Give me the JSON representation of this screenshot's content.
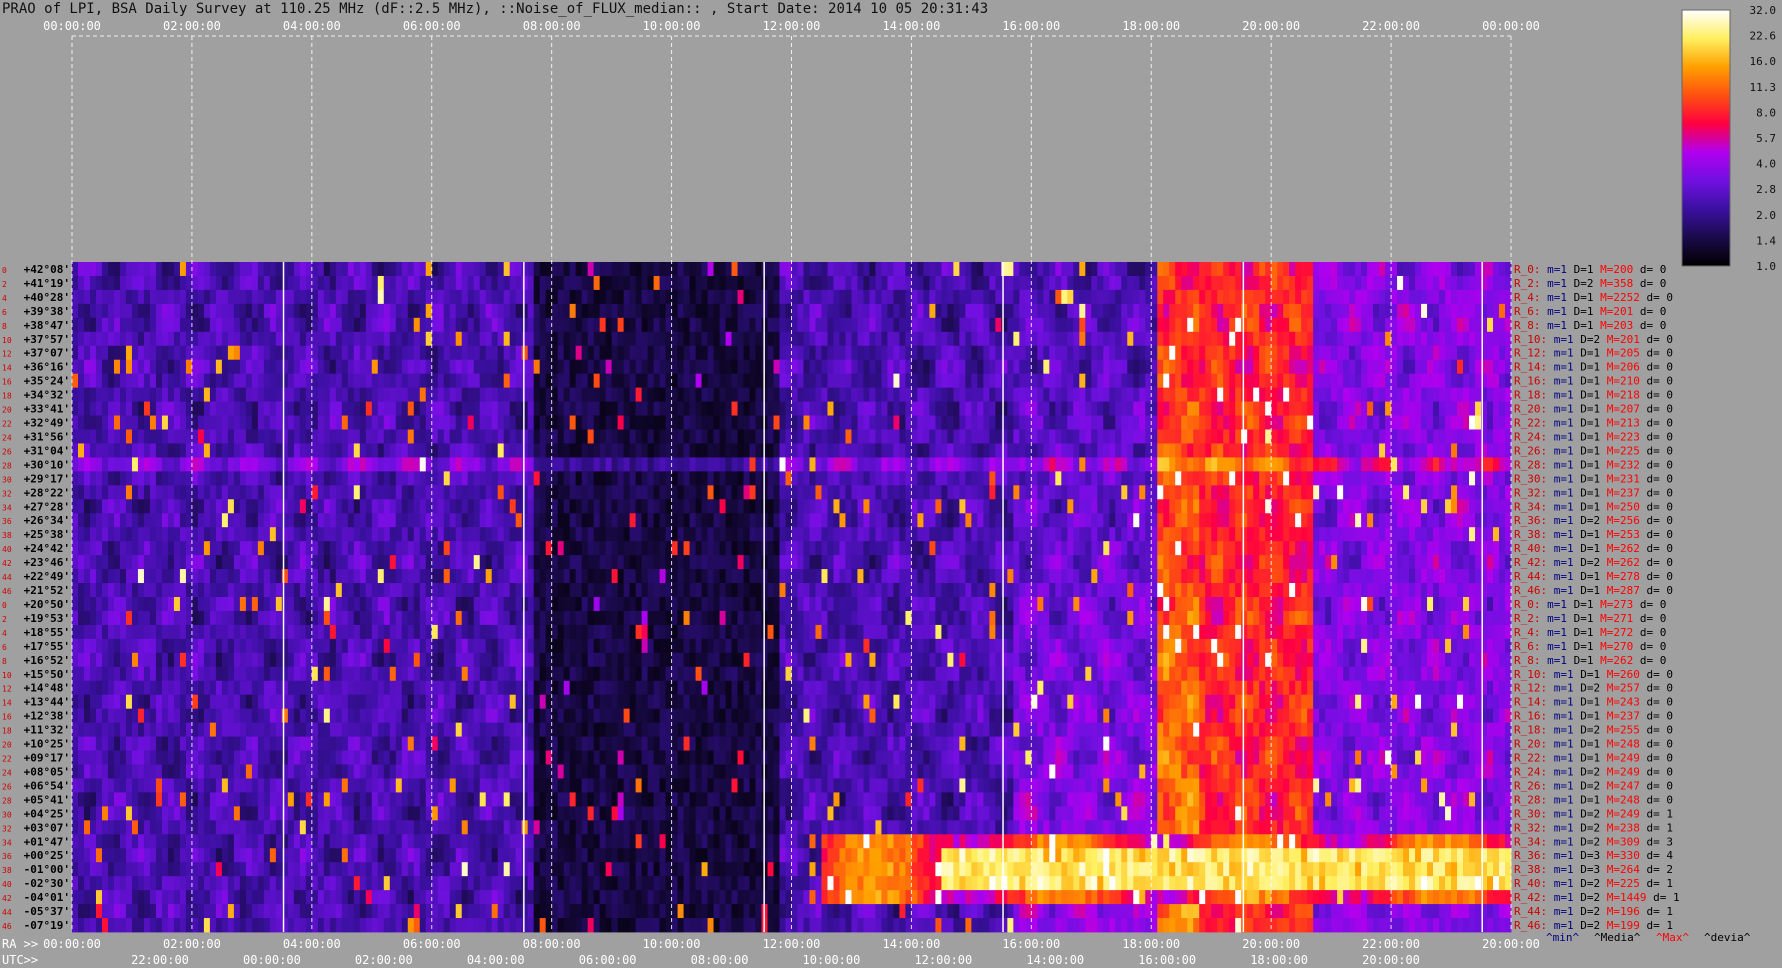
{
  "title": "PRAO of LPI, BSA Daily Survey at 110.25 MHz (dF::2.5 MHz), ::Noise_of_FLUX_median:: , Start Date: 2014 10 05 20:31:43",
  "chart_data": {
    "type": "heatmap",
    "title": "PRAO of LPI, BSA Daily Survey at 110.25 MHz (dF::2.5 MHz), ::Noise_of_FLUX_median:: , Start Date: 2014 10 05 20:31:43",
    "top_axis_ticks": [
      "00:00:00",
      "02:00:00",
      "04:00:00",
      "06:00:00",
      "08:00:00",
      "10:00:00",
      "12:00:00",
      "14:00:00",
      "16:00:00",
      "18:00:00",
      "20:00:00",
      "22:00:00",
      "00:00:00"
    ],
    "ra_axis_label": "RA >>",
    "ra_ticks": [
      "00:00:00",
      "02:00:00",
      "04:00:00",
      "06:00:00",
      "08:00:00",
      "10:00:00",
      "12:00:00",
      "14:00:00",
      "16:00:00",
      "18:00:00",
      "20:00:00",
      "22:00:00",
      "20:00:00"
    ],
    "utc_axis_label": "UTC>>",
    "utc_ticks": [
      "22:00:00",
      "00:00:00",
      "02:00:00",
      "04:00:00",
      "06:00:00",
      "08:00:00",
      "10:00:00",
      "12:00:00",
      "14:00:00",
      "16:00:00",
      "18:00:00",
      "20:00:00"
    ],
    "colorbar_ticks": [
      "32.0",
      "22.6",
      "16.0",
      "11.3",
      "8.0",
      "5.7",
      "4.0",
      "2.8",
      "2.0",
      "1.4",
      "1.0"
    ],
    "colorbar_colors": [
      "#000000",
      "#1a0a4a",
      "#3a10a0",
      "#7010e0",
      "#b000f0",
      "#ff0040",
      "#ff5010",
      "#ffa000",
      "#fff060",
      "#ffffff"
    ],
    "declinations": [
      "+42°08'",
      "+41°19'",
      "+40°28'",
      "+39°38'",
      "+38°47'",
      "+37°57'",
      "+37°07'",
      "+36°16'",
      "+35°24'",
      "+34°32'",
      "+33°41'",
      "+32°49'",
      "+31°56'",
      "+31°04'",
      "+30°10'",
      "+29°17'",
      "+28°22'",
      "+27°28'",
      "+26°34'",
      "+25°38'",
      "+24°42'",
      "+23°46'",
      "+22°49'",
      "+21°52'",
      "+20°50'",
      "+19°53'",
      "+18°55'",
      "+17°55'",
      "+16°52'",
      "+15°50'",
      "+14°48'",
      "+13°44'",
      "+12°38'",
      "+11°32'",
      "+10°25'",
      "+09°17'",
      "+08°05'",
      "+06°54'",
      "+05°41'",
      "+04°25'",
      "+03°07'",
      "+01°47'",
      "+00°25'",
      "-01°00'",
      "-02°30'",
      "-04°01'",
      "-05°37'",
      "-07°19'"
    ],
    "row_numbers": [
      "0",
      "2",
      "4",
      "6",
      "8",
      "10",
      "12",
      "14",
      "16",
      "18",
      "20",
      "22",
      "24",
      "26",
      "28",
      "30",
      "32",
      "34",
      "36",
      "38",
      "40",
      "42",
      "44",
      "46",
      "0",
      "2",
      "4",
      "6",
      "8",
      "10",
      "12",
      "14",
      "16",
      "18",
      "20",
      "22",
      "24",
      "26",
      "28",
      "30",
      "32",
      "34",
      "36",
      "38",
      "40",
      "42",
      "44",
      "46"
    ],
    "beam_stats": [
      {
        "r": "R_0:",
        "m": "m=1",
        "d": "D=1",
        "max": "M=200",
        "dev": "d= 0"
      },
      {
        "r": "R_2:",
        "m": "m=1",
        "d": "D=2",
        "max": "M=358",
        "dev": "d= 0"
      },
      {
        "r": "R_4:",
        "m": "m=1",
        "d": "D=1",
        "max": "M=2252",
        "dev": "d= 0"
      },
      {
        "r": "R_6:",
        "m": "m=1",
        "d": "D=1",
        "max": "M=201",
        "dev": "d= 0"
      },
      {
        "r": "R_8:",
        "m": "m=1",
        "d": "D=1",
        "max": "M=203",
        "dev": "d= 0"
      },
      {
        "r": "R_10:",
        "m": "m=1",
        "d": "D=2",
        "max": "M=201",
        "dev": "d= 0"
      },
      {
        "r": "R_12:",
        "m": "m=1",
        "d": "D=1",
        "max": "M=205",
        "dev": "d= 0"
      },
      {
        "r": "R_14:",
        "m": "m=1",
        "d": "D=1",
        "max": "M=206",
        "dev": "d= 0"
      },
      {
        "r": "R_16:",
        "m": "m=1",
        "d": "D=1",
        "max": "M=210",
        "dev": "d= 0"
      },
      {
        "r": "R_18:",
        "m": "m=1",
        "d": "D=1",
        "max": "M=218",
        "dev": "d= 0"
      },
      {
        "r": "R_20:",
        "m": "m=1",
        "d": "D=1",
        "max": "M=207",
        "dev": "d= 0"
      },
      {
        "r": "R_22:",
        "m": "m=1",
        "d": "D=1",
        "max": "M=213",
        "dev": "d= 0"
      },
      {
        "r": "R_24:",
        "m": "m=1",
        "d": "D=1",
        "max": "M=223",
        "dev": "d= 0"
      },
      {
        "r": "R_26:",
        "m": "m=1",
        "d": "D=1",
        "max": "M=225",
        "dev": "d= 0"
      },
      {
        "r": "R_28:",
        "m": "m=1",
        "d": "D=1",
        "max": "M=232",
        "dev": "d= 0"
      },
      {
        "r": "R_30:",
        "m": "m=1",
        "d": "D=1",
        "max": "M=231",
        "dev": "d= 0"
      },
      {
        "r": "R_32:",
        "m": "m=1",
        "d": "D=1",
        "max": "M=237",
        "dev": "d= 0"
      },
      {
        "r": "R_34:",
        "m": "m=1",
        "d": "D=1",
        "max": "M=250",
        "dev": "d= 0"
      },
      {
        "r": "R_36:",
        "m": "m=1",
        "d": "D=2",
        "max": "M=256",
        "dev": "d= 0"
      },
      {
        "r": "R_38:",
        "m": "m=1",
        "d": "D=1",
        "max": "M=253",
        "dev": "d= 0"
      },
      {
        "r": "R_40:",
        "m": "m=1",
        "d": "D=1",
        "max": "M=262",
        "dev": "d= 0"
      },
      {
        "r": "R_42:",
        "m": "m=1",
        "d": "D=2",
        "max": "M=262",
        "dev": "d= 0"
      },
      {
        "r": "R_44:",
        "m": "m=1",
        "d": "D=1",
        "max": "M=278",
        "dev": "d= 0"
      },
      {
        "r": "R_46:",
        "m": "m=1",
        "d": "D=1",
        "max": "M=287",
        "dev": "d= 0"
      },
      {
        "r": "R_0:",
        "m": "m=1",
        "d": "D=1",
        "max": "M=273",
        "dev": "d= 0"
      },
      {
        "r": "R_2:",
        "m": "m=1",
        "d": "D=1",
        "max": "M=271",
        "dev": "d= 0"
      },
      {
        "r": "R_4:",
        "m": "m=1",
        "d": "D=1",
        "max": "M=272",
        "dev": "d= 0"
      },
      {
        "r": "R_6:",
        "m": "m=1",
        "d": "D=1",
        "max": "M=270",
        "dev": "d= 0"
      },
      {
        "r": "R_8:",
        "m": "m=1",
        "d": "D=1",
        "max": "M=262",
        "dev": "d= 0"
      },
      {
        "r": "R_10:",
        "m": "m=1",
        "d": "D=1",
        "max": "M=260",
        "dev": "d= 0"
      },
      {
        "r": "R_12:",
        "m": "m=1",
        "d": "D=2",
        "max": "M=257",
        "dev": "d= 0"
      },
      {
        "r": "R_14:",
        "m": "m=1",
        "d": "D=1",
        "max": "M=243",
        "dev": "d= 0"
      },
      {
        "r": "R_16:",
        "m": "m=1",
        "d": "D=1",
        "max": "M=237",
        "dev": "d= 0"
      },
      {
        "r": "R_18:",
        "m": "m=1",
        "d": "D=2",
        "max": "M=255",
        "dev": "d= 0"
      },
      {
        "r": "R_20:",
        "m": "m=1",
        "d": "D=1",
        "max": "M=248",
        "dev": "d= 0"
      },
      {
        "r": "R_22:",
        "m": "m=1",
        "d": "D=1",
        "max": "M=249",
        "dev": "d= 0"
      },
      {
        "r": "R_24:",
        "m": "m=1",
        "d": "D=2",
        "max": "M=249",
        "dev": "d= 0"
      },
      {
        "r": "R_26:",
        "m": "m=1",
        "d": "D=2",
        "max": "M=247",
        "dev": "d= 0"
      },
      {
        "r": "R_28:",
        "m": "m=1",
        "d": "D=1",
        "max": "M=248",
        "dev": "d= 0"
      },
      {
        "r": "R_30:",
        "m": "m=1",
        "d": "D=2",
        "max": "M=249",
        "dev": "d= 1"
      },
      {
        "r": "R_32:",
        "m": "m=1",
        "d": "D=2",
        "max": "M=238",
        "dev": "d= 1"
      },
      {
        "r": "R_34:",
        "m": "m=1",
        "d": "D=2",
        "max": "M=309",
        "dev": "d= 3"
      },
      {
        "r": "R_36:",
        "m": "m=1",
        "d": "D=3",
        "max": "M=330",
        "dev": "d= 4"
      },
      {
        "r": "R_38:",
        "m": "m=1",
        "d": "D=3",
        "max": "M=264",
        "dev": "d= 2"
      },
      {
        "r": "R_40:",
        "m": "m=1",
        "d": "D=2",
        "max": "M=225",
        "dev": "d= 1"
      },
      {
        "r": "R_42:",
        "m": "m=1",
        "d": "D=2",
        "max": "M=1449",
        "dev": "d= 1"
      },
      {
        "r": "R_44:",
        "m": "m=1",
        "d": "D=2",
        "max": "M=196",
        "dev": "d= 1"
      },
      {
        "r": "R_46:",
        "m": "m=1",
        "d": "D=2",
        "max": "M=199",
        "dev": "d= 1"
      }
    ],
    "stats_legend": [
      "^min^",
      "^Media^",
      "^Max^",
      "^devia^"
    ],
    "legend_colors": {
      "min": "#000080",
      "median": "#000000",
      "max": "#ff0000",
      "dev": "#000000",
      "row": "#d00000"
    }
  }
}
